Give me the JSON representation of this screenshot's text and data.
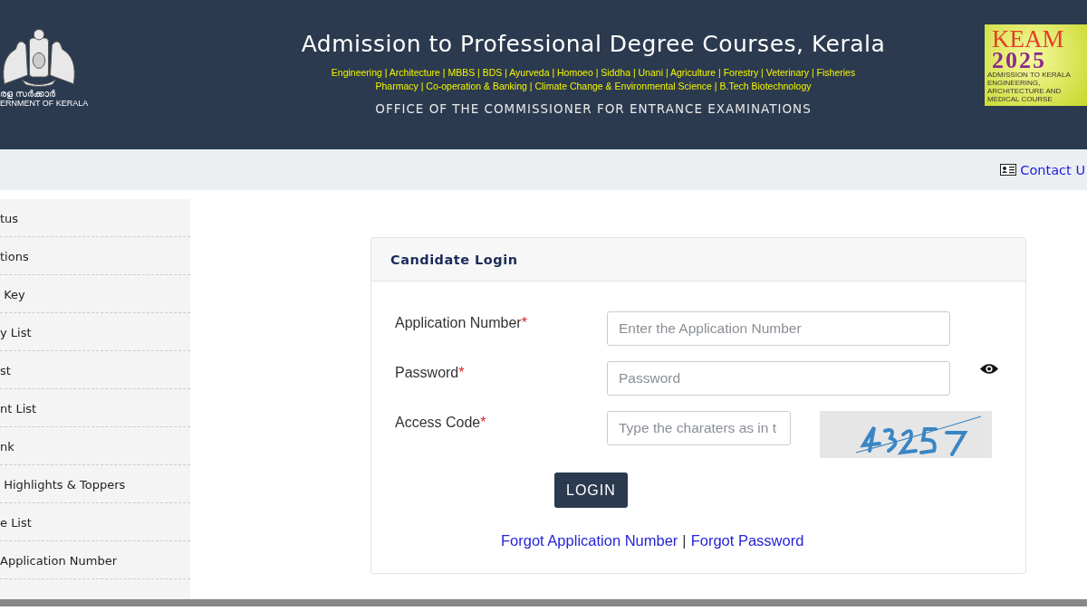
{
  "header": {
    "emblem_caption": [
      "രള സർക്കാർ",
      "ERNMENT OF KERALA"
    ],
    "title": "Admission to Professional Degree Courses, Kerala",
    "courses": [
      "Engineering | Architecture | MBBS | BDS | Ayurveda | Homoeo | Siddha | Unani | Agriculture | Forestry | Veterinary | Fisheries",
      "Pharmacy | Co-operation & Banking | Climate Change & Environmental Science | B.Tech Biotechnology"
    ],
    "office": "OFFICE OF THE COMMISSIONER FOR ENTRANCE EXAMINATIONS",
    "badge": {
      "name": "KEAM",
      "year": "2025",
      "caption": [
        "ADMISSION TO KERALA ENGINEERING,",
        "ARCHITECTURE AND MEDICAL COURSE"
      ]
    }
  },
  "nav": {
    "contact": "Contact U"
  },
  "sidebar": {
    "items": [
      {
        "label": "tus"
      },
      {
        "label": "tions"
      },
      {
        "label": " Key"
      },
      {
        "label": "y List"
      },
      {
        "label": "st"
      },
      {
        "label": "nt List"
      },
      {
        "label": "nk"
      },
      {
        "label": " Highlights & Toppers"
      },
      {
        "label": "e List"
      },
      {
        "label": "Application Number"
      }
    ]
  },
  "login": {
    "title": "Candidate Login",
    "fields": [
      {
        "kind": "text",
        "label": "Application Number",
        "required_mark": "*",
        "placeholder": "Enter the Application Number"
      },
      {
        "kind": "password",
        "label": "Password",
        "required_mark": "*",
        "placeholder": "Password"
      },
      {
        "kind": "captcha",
        "label": "Access Code",
        "required_mark": "*",
        "placeholder": "Type the charaters as in t"
      }
    ],
    "button": "LOGIN",
    "links": [
      "Forgot Application Number",
      "Forgot Password"
    ],
    "separator": "|"
  }
}
